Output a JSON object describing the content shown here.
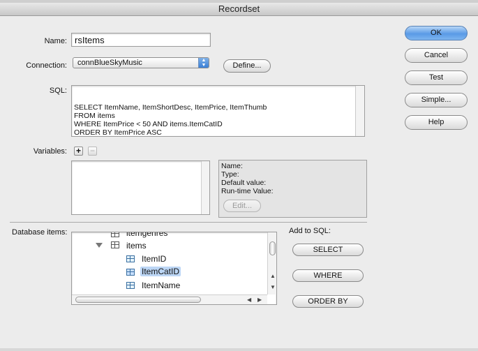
{
  "window": {
    "title": "Recordset"
  },
  "form": {
    "name_label": "Name:",
    "name_value": "rsItems",
    "connection_label": "Connection:",
    "connection_value": "connBlueSkyMusic",
    "define_button": "Define...",
    "sql_label": "SQL:",
    "sql_text": "SELECT ItemName, ItemShortDesc, ItemPrice, ItemThumb\nFROM items\nWHERE ItemPrice < 50 AND items.ItemCatID\nORDER BY ItemPrice ASC",
    "variables_label": "Variables:",
    "add_variable": "+",
    "remove_variable": "−"
  },
  "variable_info": {
    "name": "Name:",
    "type": "Type:",
    "default_value": "Default value:",
    "runtime_value": "Run-time Value:",
    "edit_button": "Edit..."
  },
  "database": {
    "label": "Database items:",
    "partial_item": "itemgenres",
    "table": "items",
    "columns": [
      "ItemID",
      "ItemCatID",
      "ItemName"
    ],
    "selected_column": "ItemCatID"
  },
  "add_to_sql": {
    "label": "Add to SQL:",
    "select": "SELECT",
    "where": "WHERE",
    "order_by": "ORDER BY"
  },
  "side_buttons": {
    "ok": "OK",
    "cancel": "Cancel",
    "test": "Test",
    "simple": "Simple...",
    "help": "Help"
  }
}
